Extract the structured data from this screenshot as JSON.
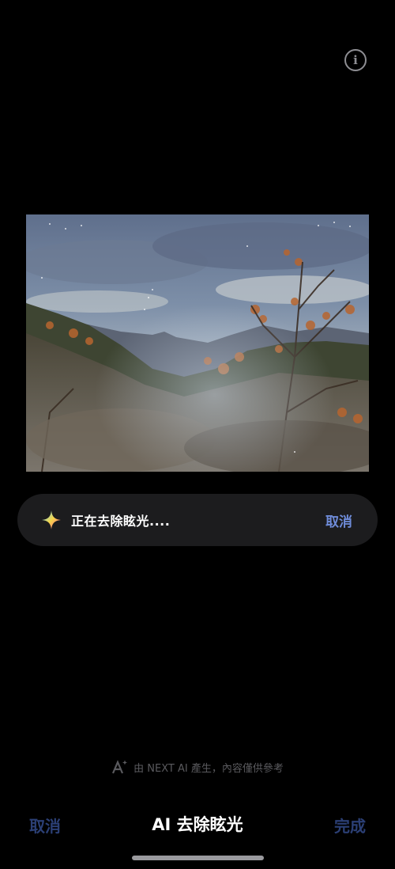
{
  "header": {
    "info_icon": "info-icon"
  },
  "photo": {
    "description_icon": "landscape-photo"
  },
  "status": {
    "text": "正在去除眩光....",
    "cancel_label": "取消",
    "icon": "sparkle-icon"
  },
  "disclaimer": {
    "icon": "ai-sparkle-icon",
    "text": "由 NEXT AI 產生，內容僅供參考"
  },
  "bottom_bar": {
    "cancel_label": "取消",
    "title": "AI 去除眩光",
    "done_label": "完成"
  },
  "colors": {
    "accent": "#6e8bd8",
    "disabled_accent": "#2b3f75",
    "background": "#000000",
    "pill": "#1c1c1e"
  }
}
